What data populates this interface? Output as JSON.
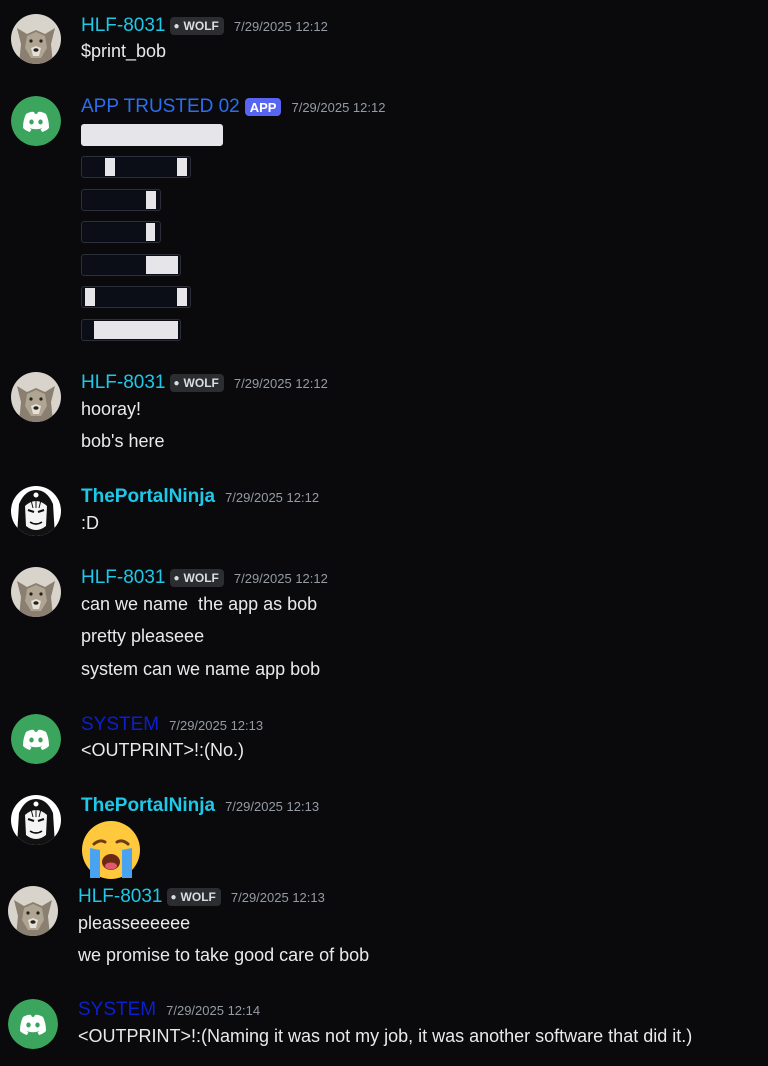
{
  "messages": [
    {
      "author": "HLF-8031",
      "tag": "WOLF",
      "timestamp": "7/29/2025 12:12",
      "lines": [
        "$print_bob"
      ]
    },
    {
      "author": "APP TRUSTED 02",
      "tag": "APP",
      "timestamp": "7/29/2025 12:12"
    },
    {
      "author": "HLF-8031",
      "tag": "WOLF",
      "timestamp": "7/29/2025 12:12",
      "lines": [
        "hooray!",
        "bob's here"
      ]
    },
    {
      "author": "ThePortalNinja",
      "timestamp": "7/29/2025 12:12",
      "lines": [
        ":D"
      ]
    },
    {
      "author": "HLF-8031",
      "tag": "WOLF",
      "timestamp": "7/29/2025 12:12",
      "lines": [
        "can we name  the app as bob",
        "pretty pleaseee",
        "system can we name app bob"
      ]
    },
    {
      "author": "SYSTEM",
      "timestamp": "7/29/2025 12:13",
      "lines": [
        "<OUTPRINT>!:(No.)"
      ]
    },
    {
      "author": "ThePortalNinja",
      "timestamp": "7/29/2025 12:13",
      "emoji": "crying-face"
    },
    {
      "author": "HLF-8031",
      "tag": "WOLF",
      "timestamp": "7/29/2025 12:13",
      "lines": [
        "pleasseeeeee",
        "we promise to take good care of bob"
      ]
    },
    {
      "author": "SYSTEM",
      "timestamp": "7/29/2025 12:14",
      "lines": [
        "<OUTPRINT>!:(Naming it was not my job, it was another software that did it.)"
      ]
    }
  ],
  "colors": {
    "background": "#0a0a0c",
    "username_cyan": "#1ec8e8",
    "app_blue": "#2b6ef0",
    "system_blue": "#0a1fd0",
    "discord_green": "#3ba55d",
    "app_badge": "#5865f2"
  },
  "icons": {
    "wolf_avatar": "wolf-avatar",
    "ninja_avatar": "ninja-avatar",
    "discord_avatar": "discord-logo-icon",
    "tag_icon": "paw-icon"
  }
}
